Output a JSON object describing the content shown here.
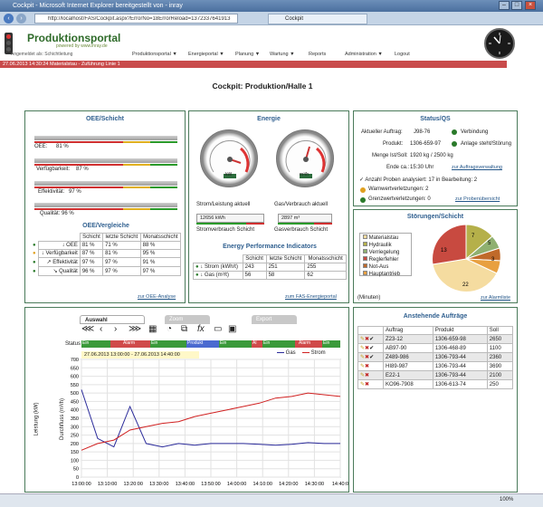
{
  "window": {
    "title": "Cockpit - Microsoft Internet Explorer bereitgestellt von - inray",
    "address": "http://localhost/FAS/Cockpit.aspx?ErrorNo=18ErrorReload=1372337641913",
    "tab": "Cockpit",
    "zoom": "100%"
  },
  "header": {
    "logo": "Produktionsportal",
    "logo_sub": "powered by www.inray.de",
    "user": "Angemeldet als: Schichtleitung",
    "nav": [
      "Produktionsportal ▼",
      "Energieportal ▼",
      "Planung ▼",
      "Wartung ▼",
      "Reports",
      "Administration ▼",
      "Logout"
    ],
    "status": "27.06.2013 14:30:24   Materialstau - Zuführung Linie 1"
  },
  "page_title": "Cockpit: Produktion/Halle 1",
  "oee": {
    "title": "OEE/Schicht",
    "metrics": [
      {
        "label": "OEE:",
        "value": "81 %",
        "fill": 0.81
      },
      {
        "label": "Verfügbarkeit:",
        "value": "87 %",
        "fill": 0.87
      },
      {
        "label": "Effektivität:",
        "value": "97 %",
        "fill": 0.97
      },
      {
        "label": "Qualität:",
        "value": "96 %",
        "fill": 0.96
      }
    ],
    "compare_title": "OEE/Vergleiche",
    "headers": [
      "Schicht",
      "letzte Schicht",
      "Monatsschicht"
    ],
    "rows": [
      {
        "label": "OEE",
        "values": [
          "81 %",
          "71 %",
          "88 %"
        ],
        "color": "#2a7a2a",
        "arrow": "↓"
      },
      {
        "label": "Verfügbarkeit",
        "values": [
          "87 %",
          "81 %",
          "95 %"
        ],
        "color": "#e0a020",
        "arrow": "↓"
      },
      {
        "label": "Effektivität",
        "values": [
          "97 %",
          "97 %",
          "91 %"
        ],
        "color": "#2a7a2a",
        "arrow": "↗"
      },
      {
        "label": "Qualität",
        "values": [
          "96 %",
          "97 %",
          "97 %"
        ],
        "color": "#2a7a2a",
        "arrow": "↘"
      }
    ],
    "link": "zur OEE-Analyse"
  },
  "energy": {
    "title": "Energie",
    "gauge1_unit": "kW",
    "gauge2_unit": "m³/h",
    "gauge1_caption": "Strom/Leistung aktuell",
    "gauge2_caption": "Gas/Verbrauch aktuell",
    "strom_value": "12656 kWh",
    "gas_value": "2897 m³",
    "strom_caption": "Stromverbrauch Schicht",
    "gas_caption": "Gasverbrauch Schicht",
    "epi_title": "Energy Performance Indicators",
    "headers": [
      "Schicht",
      "letzte Schicht",
      "Monatsschicht"
    ],
    "rows": [
      {
        "label": "Strom (kWh/t)",
        "values": [
          "243",
          "251",
          "255"
        ]
      },
      {
        "label": "Gas (m³/t)",
        "values": [
          "56",
          "58",
          "62"
        ]
      }
    ],
    "link": "zum FAS-Energieportal"
  },
  "status_qs": {
    "title": "Status/QS",
    "auftrag_label": "Aktueller Auftrag:",
    "auftrag": "J98-76",
    "produkt_label": "Produkt:",
    "produkt": "1306-659-97",
    "menge_label": "Menge Ist/Soll:",
    "menge": "1920 kg / 2500 kg",
    "ende_label": "Ende ca.:",
    "ende": "15:30 Uhr",
    "verbindung": "Verbindung",
    "anlage": "Anlage steht/Störung",
    "auftragsverwaltung": "zur Auftragsverwaltung",
    "proben": "Anzahl Proben analysiert: 17 in Bearbeitung: 2",
    "warn": "Warnwertverletzungen: 2",
    "grenz": "Grenzwertverletzungen: 0",
    "proben_link": "zur Probenübersicht"
  },
  "stoerungen": {
    "title": "Störungen/Schicht",
    "unit": "(Minuten)",
    "link": "zur Alarmliste",
    "legend": [
      {
        "name": "Materialstau",
        "color": "#f5dca0"
      },
      {
        "name": "Hydraulik",
        "color": "#b5b04a"
      },
      {
        "name": "Verriegelung",
        "color": "#8fb070"
      },
      {
        "name": "Reglerfehler",
        "color": "#c84a40"
      },
      {
        "name": "Not-Aus",
        "color": "#c06a2a"
      },
      {
        "name": "Hauptantrieb",
        "color": "#e8a040"
      }
    ]
  },
  "chart_panel": {
    "tabs": [
      "Auswahl",
      "Zoom",
      "Export"
    ],
    "range_label": "27.06.2013 13:00:00 - 27.06.2013 14:40:00",
    "status_label": "Status",
    "status_segments": [
      {
        "label": "Ein",
        "color": "#3a9a3a"
      },
      {
        "label": "Alarm",
        "color": "#d04a4a"
      },
      {
        "label": "Ein",
        "color": "#3a9a3a"
      },
      {
        "label": "Produkt",
        "color": "#4a6ad0"
      },
      {
        "label": "Ein",
        "color": "#3a9a3a"
      },
      {
        "label": "Al",
        "color": "#d04a4a"
      },
      {
        "label": "Ein",
        "color": "#3a9a3a"
      },
      {
        "label": "Alarm",
        "color": "#d04a4a"
      },
      {
        "label": "Ein",
        "color": "#3a9a3a"
      }
    ],
    "legend_gas": "Gas",
    "legend_strom": "Strom"
  },
  "chart_data": {
    "type": "line",
    "ylabel": "Leistung (kW)",
    "y2label": "Durchfluss (m³/h)",
    "ylim": [
      0,
      700
    ],
    "x": [
      "13:00:00",
      "13:10:00",
      "13:20:00",
      "13:30:00",
      "13:40:00",
      "13:50:00",
      "14:00:00",
      "14:10:00",
      "14:20:00",
      "14:30:00",
      "14:40:0"
    ],
    "yticks": [
      "0",
      "50",
      "100",
      "150",
      "200",
      "250",
      "300",
      "350",
      "400",
      "450",
      "500",
      "550",
      "600",
      "650",
      "700"
    ],
    "series": [
      {
        "name": "Gas",
        "color": "#2a2a9a",
        "values": [
          520,
          230,
          180,
          420,
          200,
          180,
          200,
          190,
          200,
          200,
          200,
          195,
          190,
          195,
          205,
          200,
          200
        ]
      },
      {
        "name": "Strom",
        "color": "#d02020",
        "values": [
          160,
          200,
          220,
          280,
          300,
          320,
          330,
          360,
          380,
          400,
          420,
          440,
          470,
          480,
          500,
          490,
          480
        ]
      }
    ]
  },
  "orders": {
    "title": "Anstehende Aufträge",
    "headers": [
      "Auftrag",
      "Produkt",
      "Soll"
    ],
    "rows": [
      [
        "Z23-12",
        "1306-659-98",
        "2650"
      ],
      [
        "AB97-90",
        "1306-468-89",
        "1100"
      ],
      [
        "Z489-986",
        "1306-793-44",
        "2360"
      ],
      [
        "HI89-987",
        "1306-793-44",
        "3690"
      ],
      [
        "E22-1",
        "1306-793-44",
        "2100"
      ],
      [
        "KO96-7908",
        "1306-613-74",
        "250"
      ]
    ]
  }
}
